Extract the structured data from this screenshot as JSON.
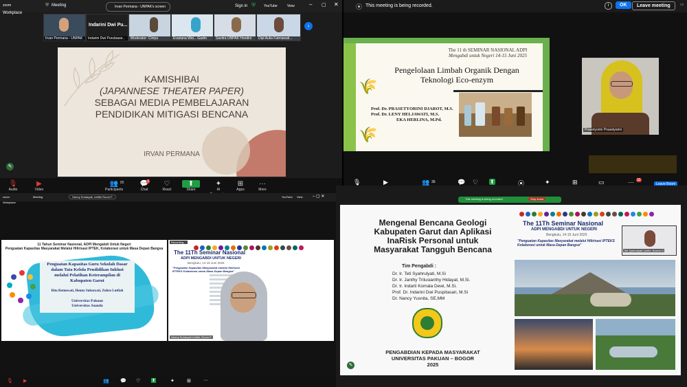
{
  "q1": {
    "app": "zoom",
    "app_sub": "Workplace",
    "meeting_label": "Meeting",
    "share_label": "Irvan Permana - UNPAK's screen",
    "view_label": "View",
    "signin_label": "Sign in",
    "youtube_label": "YouTube",
    "thumbs": [
      "Irvan Permana - UNPAK",
      "Indarini Dwi Pu...",
      "Indarini Dwi Purubasar...",
      "Moderator- Cintya",
      "Evariana Wid... Gadm",
      "Savitra UNPAK Hoedini",
      "Dipl Aulia Fatmawati..."
    ],
    "slide_title": "KAMISHIBAI (JAPANNESE THEATER PAPER) SEBAGAI MEDIA PEMBELAJARAN PENDIDIKAN MITIGASI BENCANA",
    "slide_line1": "KAMISHIBAI",
    "slide_line2": "(JAPANNESE THEATER PAPER)",
    "slide_line3": "SEBAGAI MEDIA PEMBELAJARAN",
    "slide_line4": "PENDIDIKAN MITIGASI BENCANA",
    "slide_author": "IRVAN PERMANA",
    "toolbar": [
      {
        "icon": "mic-icon",
        "glyph": "🎙",
        "label": "Audio"
      },
      {
        "icon": "video-icon",
        "glyph": "▶",
        "label": "Video"
      },
      {
        "icon": "participants-icon",
        "glyph": "👥",
        "label": "Participants"
      },
      {
        "icon": "chat-icon",
        "glyph": "💬",
        "label": "Chat"
      },
      {
        "icon": "react-icon",
        "glyph": "♡",
        "label": "React"
      },
      {
        "icon": "share-icon",
        "glyph": "⬆",
        "label": "Share"
      },
      {
        "icon": "ai-companion-icon",
        "glyph": "✦",
        "label": "AI Companion"
      },
      {
        "icon": "apps-icon",
        "glyph": "⊞",
        "label": "Apps"
      },
      {
        "icon": "more-icon",
        "glyph": "···",
        "label": "More"
      }
    ],
    "participants_count": "85",
    "chat_badge": "3"
  },
  "q2": {
    "recording_text": "This meeting is being recorded.",
    "ok_label": "OK",
    "leave_label": "Leave meeting",
    "slide_header1": "The 11 th SEMINAR NASIONAL ADPI",
    "slide_header2": "Mengabdi untuk Negeri 14-15 Juni 2025",
    "slide_title1": "Pengelolaan Limbah Organik Dengan",
    "slide_title2": "Teknologi Eco-enzym",
    "authors": [
      "Prof. Dr. PRASETYORINI DJAROT, M.S.",
      "Prof. Dr. LENY HELJAWATI, M.S.",
      "EKA HERLINA, M.Pd."
    ],
    "participant_name": "Prasetyorini Prasetyorini",
    "participants_count": "35",
    "badge": "32",
    "leave_room": "Leave Room"
  },
  "q3": {
    "app": "zoom",
    "app_sub": "Workplace",
    "meeting_label": "Meeting",
    "share_label": "Henny Suharyati, Unifitri Room P",
    "view_label": "View",
    "youtube_label": "YouTube",
    "left_header1": "11 Tahun Seminar Nasional, ADPI Mengabdi Untuk Negeri",
    "left_header2": "Penguatan Kapasitas Masyarakat Melalui Hilirisasi IPTEK, Kolaborasi untuk Masa Depan Bangsa",
    "left_title1": "Penguatan Kapasitas Guru Sekolah Dasar",
    "left_title2": "dalam Tata Kelola Pendidikan Inklusi",
    "left_title3": "melalui Pelatihan Keterampilan di",
    "left_title4": "Kabupaten Garut",
    "left_authors": "Rita Retnowati, Henny Suharyati, Zuhro Lutfiah",
    "left_inst1": "Universitas Pakuan",
    "left_inst2": "Universitas Juanda",
    "right_badge": "Recording...",
    "right_title": "The 11Th Seminar Nasional",
    "right_sub1": "ADPI MENGABDI UNTUK NEGERI",
    "right_sub2": "Bengkulu, 14-15 Juni 2025",
    "right_theme": "\"Penguatan Kapasitas Masyarakat melalui Hilirisasi IPTEKS Kolaborasi untuk Masa Depan Bangsa\"",
    "speaker_name": "Henny Suharyati Unifitri, Room P"
  },
  "q4": {
    "recording_pill": "This meeting is being recorded",
    "stop_label": "Stop share",
    "title1": "Mengenal Bencana Geologi",
    "title2": "Kabupaten Garut dan Aplikasi",
    "title3": "InaRisk Personal untuk",
    "title4": "Masyarakat Tangguh Bencana",
    "team_label": "Tim Pengabdi :",
    "team": [
      "Dr. Ir. Teti Syahrulyati, M.Si",
      "Dr. Ir. Janthy Trilusianthy Hidayat, M.Si.",
      "Dr. Ir. Indarti Komala Dewi, M.Si.",
      "Prof. Dr. Indarini Dwi Puspitasari, M.Si",
      "Dr. Nancy Yusnita, SE,MM"
    ],
    "footer1": "PENGABDIAN KEPADA MASYARAKAT",
    "footer2": "UNIVERSITAS PAKUAN – BOGOR",
    "footer3": "2025",
    "seminar_title": "The 11Th Seminar Nasional",
    "seminar_sub1": "ADPI MENGABDI UNTUK NEGERI",
    "seminar_sub2": "Bengkulu, 14-15 Juni 2025",
    "seminar_theme": "\"Penguatan Kapasitas Masyarakat melalui Hilirisasi IPTEKS Kolaborasi untuk Masa Depan Bangsa\"",
    "speaker_tile": "Teti Syahrulyati Unifitri, Bozem D"
  },
  "colors": {
    "zoom_blue": "#0e72ed",
    "slide1_bg": "#ece6dc",
    "slide1_text": "#4a3f3a",
    "rust": "#c47a6a",
    "green_leaf": "#8bc34a",
    "cyan_brush": "#19b3d6",
    "navy": "#1a2a6c",
    "green_pill": "#1f8f3a"
  }
}
